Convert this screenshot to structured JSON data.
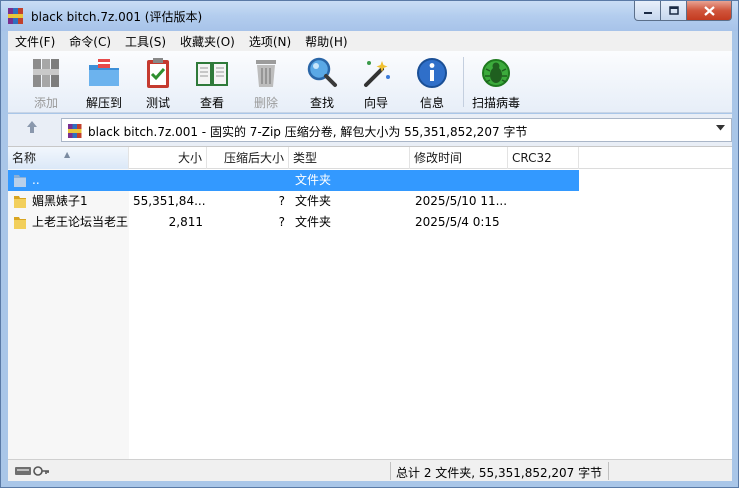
{
  "window": {
    "title": "black bitch.7z.001 (评估版本)"
  },
  "menu": [
    "文件(F)",
    "命令(C)",
    "工具(S)",
    "收藏夹(O)",
    "选项(N)",
    "帮助(H)"
  ],
  "toolbar": {
    "add": "添加",
    "extract": "解压到",
    "test": "测试",
    "view": "查看",
    "delete": "删除",
    "find": "查找",
    "wizard": "向导",
    "info": "信息",
    "scan": "扫描病毒"
  },
  "address": {
    "text": "black bitch.7z.001 - 固实的 7-Zip 压缩分卷, 解包大小为 55,351,852,207 字节"
  },
  "columns": {
    "name": "名称",
    "size": "大小",
    "packed": "压缩后大小",
    "type": "类型",
    "modified": "修改时间",
    "crc": "CRC32"
  },
  "rows": [
    {
      "name": "..",
      "size": "",
      "packed": "",
      "type": "文件夹",
      "modified": "",
      "crc": ""
    },
    {
      "name": "媚黑婊子1",
      "size": "55,351,84...",
      "packed": "?",
      "type": "文件夹",
      "modified": "2025/5/10 11...",
      "crc": ""
    },
    {
      "name": "上老王论坛当老王",
      "size": "2,811",
      "packed": "?",
      "type": "文件夹",
      "modified": "2025/5/4 0:15",
      "crc": ""
    }
  ],
  "status": {
    "summary": "总计 2 文件夹, 55,351,852,207 字节"
  },
  "colors": {
    "selection": "#3399ff",
    "titlebar": "#b3cdee",
    "close_button": "#c43b20"
  }
}
